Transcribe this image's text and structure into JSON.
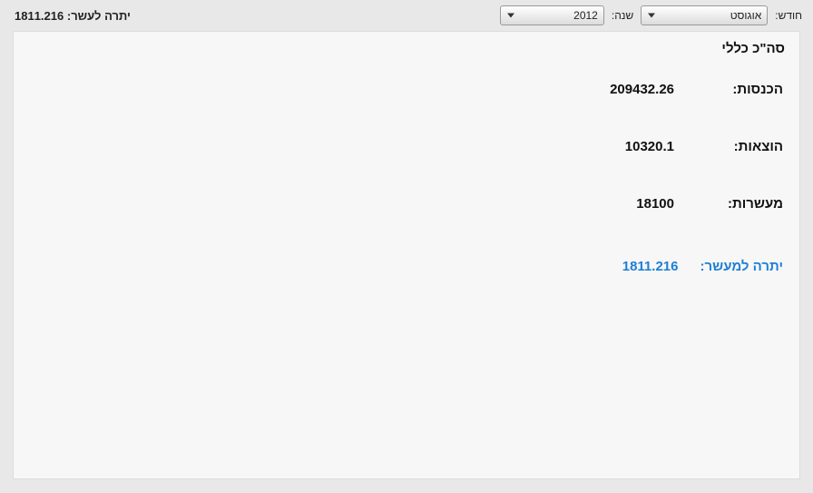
{
  "topbar": {
    "month_label": "חודש:",
    "month_value": "אוגוסט",
    "year_label": "שנה:",
    "year_value": "2012",
    "tithe_balance_label": "יתרה לעשר:",
    "tithe_balance_value": "1811.216"
  },
  "panel": {
    "title": "סה\"כ כללי",
    "income_label": "הכנסות:",
    "income_value": "209432.26",
    "expenses_label": "הוצאות:",
    "expenses_value": "10320.1",
    "tithes_label": "מעשרות:",
    "tithes_value": "18100",
    "remaining_tithe_label": "יתרה למעשר:",
    "remaining_tithe_value": "1811.216"
  }
}
